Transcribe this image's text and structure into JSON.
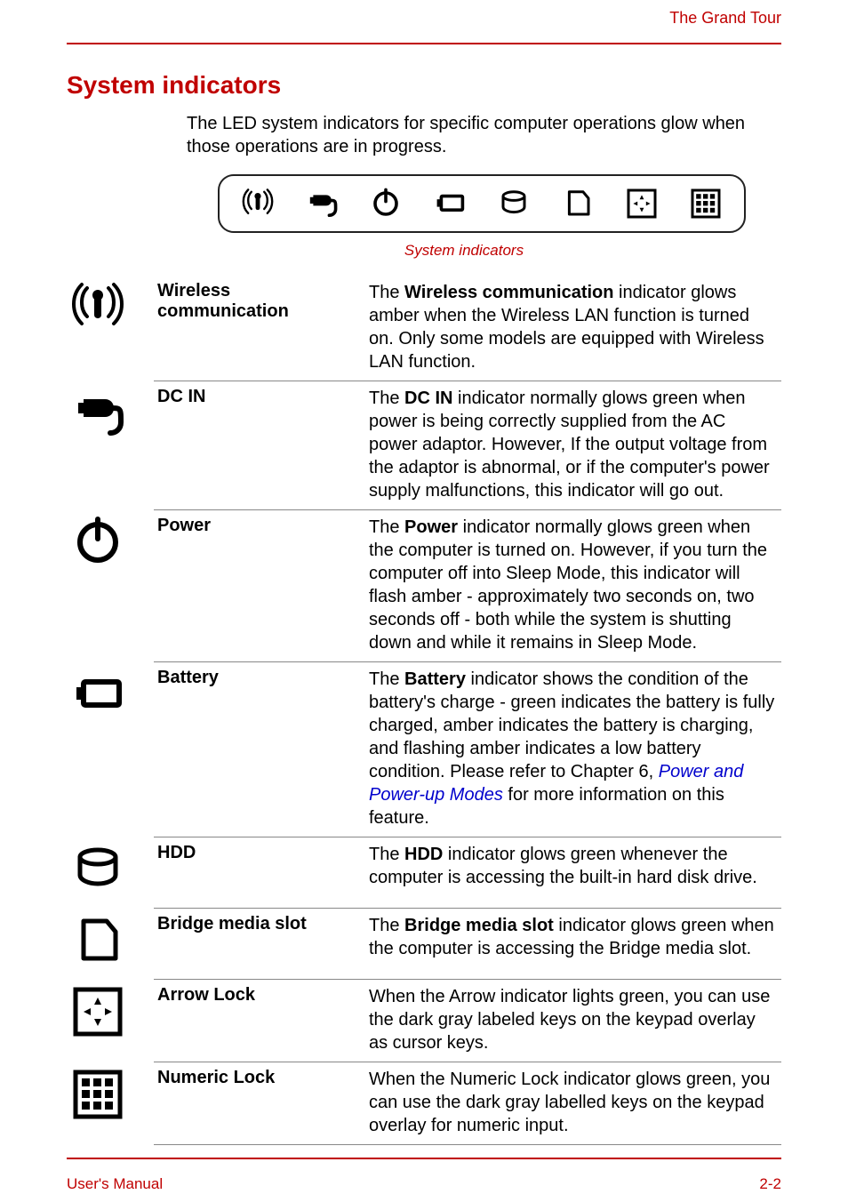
{
  "header": {
    "title": "The Grand Tour"
  },
  "section": {
    "title": "System indicators",
    "intro": "The LED system indicators for specific computer operations glow when those operations are in progress.",
    "caption": "System indicators"
  },
  "rows": [
    {
      "label": "Wireless communication",
      "desc_pre": "The ",
      "desc_bold": "Wireless communication",
      "desc_post": " indicator glows amber when the Wireless LAN function is turned on. Only some models are equipped with Wireless LAN function."
    },
    {
      "label": "DC IN",
      "desc_pre": "The ",
      "desc_bold": "DC IN",
      "desc_post": " indicator normally glows green when power is being correctly supplied from the AC power adaptor. However, If the output voltage from the adaptor is abnormal, or if the computer's power supply malfunctions, this indicator will go out."
    },
    {
      "label": "Power",
      "desc_pre": "The ",
      "desc_bold": "Power",
      "desc_post": " indicator normally glows green when the computer is turned on. However, if you turn the computer off into Sleep Mode, this indicator will flash amber - approximately two seconds on, two seconds off - both while the system is shutting down and while it remains in Sleep Mode."
    },
    {
      "label": "Battery",
      "desc_pre": "The ",
      "desc_bold": "Battery",
      "desc_post": " indicator shows the condition of the battery's charge - green indicates the battery is fully charged, amber indicates the battery is charging, and flashing amber indicates a low battery condition. Please refer to Chapter 6, ",
      "desc_link": "Power and Power-up Modes",
      "desc_tail": " for more information on this feature."
    },
    {
      "label": "HDD",
      "desc_pre": "The ",
      "desc_bold": "HDD",
      "desc_post": " indicator glows green whenever the computer is accessing the built-in hard disk drive."
    },
    {
      "label": "Bridge media slot",
      "desc_pre": "The ",
      "desc_bold": "Bridge media slot",
      "desc_post": " indicator glows green when the computer is accessing the Bridge media slot."
    },
    {
      "label": "Arrow Lock",
      "desc_full": "When the Arrow indicator lights green, you can use the dark gray labeled keys on the keypad overlay as cursor keys."
    },
    {
      "label": "Numeric Lock",
      "desc_full": "When the Numeric Lock indicator glows green, you can use the dark gray labelled keys on the keypad overlay for numeric input."
    }
  ],
  "footer": {
    "left": "User's Manual",
    "right": "2-2"
  }
}
